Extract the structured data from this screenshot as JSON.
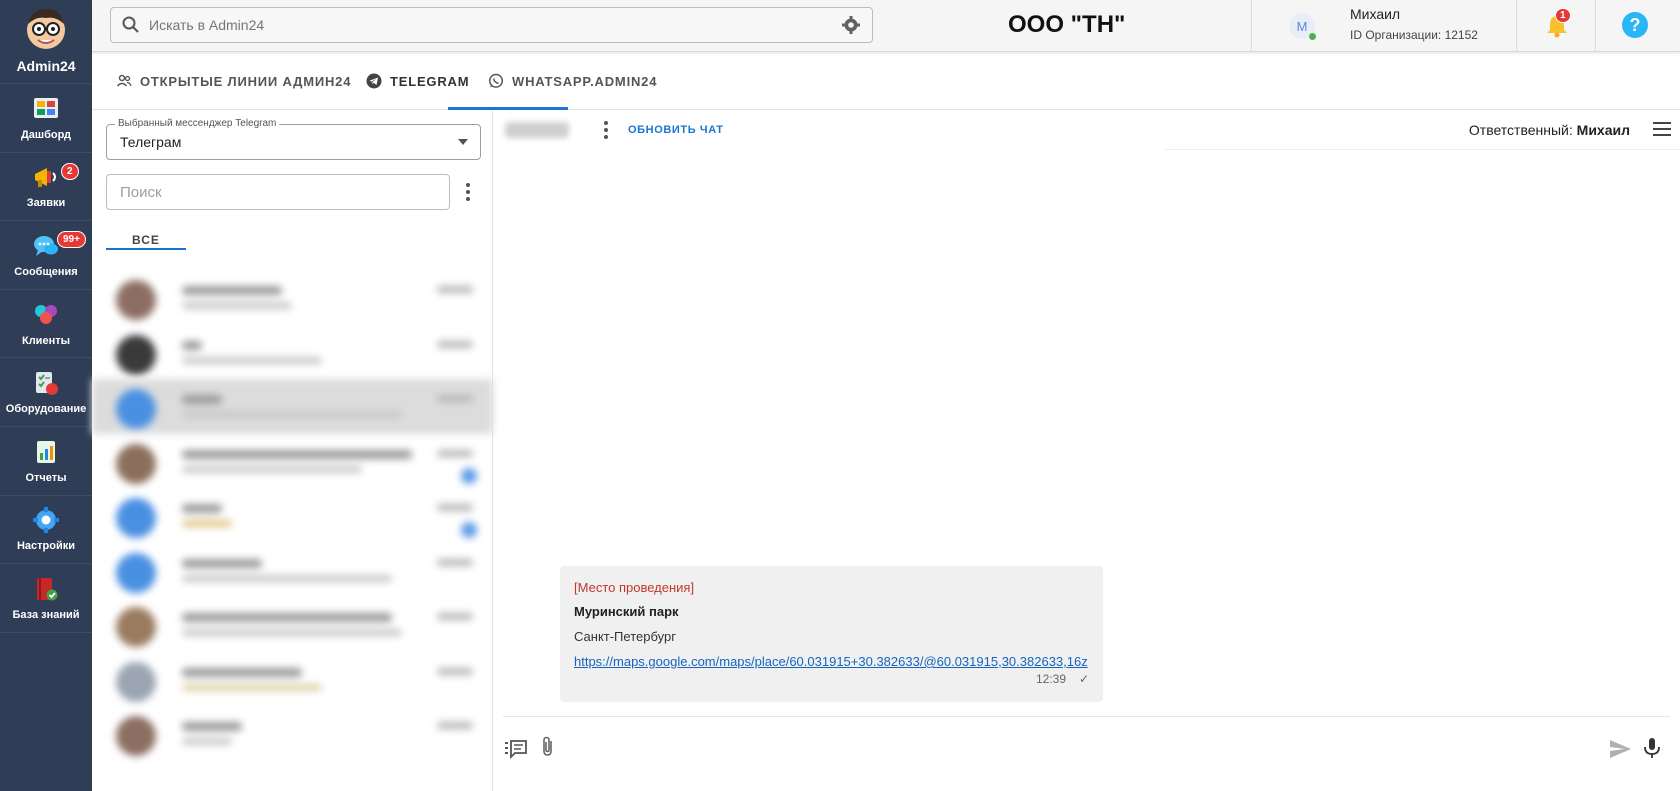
{
  "brand": {
    "name": "Admin24"
  },
  "sidebar": {
    "items": [
      {
        "label": "Дашборд",
        "icon": "dashboard-icon",
        "badge": ""
      },
      {
        "label": "Заявки",
        "icon": "megaphone-icon",
        "badge": "2"
      },
      {
        "label": "Сообщения",
        "icon": "chat-bubbles-icon",
        "badge": "99+"
      },
      {
        "label": "Клиенты",
        "icon": "clients-icon",
        "badge": ""
      },
      {
        "label": "Оборудование",
        "icon": "equipment-icon",
        "badge": ""
      },
      {
        "label": "Отчеты",
        "icon": "reports-icon",
        "badge": ""
      },
      {
        "label": "Настройки",
        "icon": "settings-gear-icon",
        "badge": ""
      },
      {
        "label": "База знаний",
        "icon": "knowledge-book-icon",
        "badge": ""
      }
    ]
  },
  "topbar": {
    "search_placeholder": "Искать в Admin24",
    "org_title": "ООО \"ТН\"",
    "user_initial": "М",
    "user_name": "Михаил",
    "user_org": "ID Организации: 12152",
    "notifications_count": "1",
    "help_label": "?"
  },
  "tabs": [
    {
      "label": "ОТКРЫТЫЕ ЛИНИИ АДМИН24",
      "icon": "group-icon",
      "active": false
    },
    {
      "label": "TELEGRAM",
      "icon": "telegram-icon",
      "active": true
    },
    {
      "label": "WHATSAPP.ADMIN24",
      "icon": "whatsapp-icon",
      "active": false
    }
  ],
  "left_panel": {
    "messenger_legend": "Выбранный мессенджер Telegram",
    "messenger_value": "Телеграм",
    "search_placeholder": "Поиск",
    "filter_tab": "ВСЕ"
  },
  "chat": {
    "refresh_label": "ОБНОВИТЬ ЧАТ",
    "responsible_label": "Ответственный:",
    "responsible_name": "Михаил",
    "message": {
      "tag": "[Место проведения]",
      "title": "Муринский парк",
      "city": "Санкт-Петербург",
      "link": "https://maps.google.com/maps/place/60.031915+30.382633/@60.031915,30.382633,16z",
      "time": "12:39",
      "status": "✓"
    }
  },
  "colors": {
    "sidebar_bg": "#2f3e56",
    "accent": "#1976d2",
    "badge": "#e53935",
    "message_bg": "#f0f0f0",
    "message_tag": "#c0392b"
  }
}
